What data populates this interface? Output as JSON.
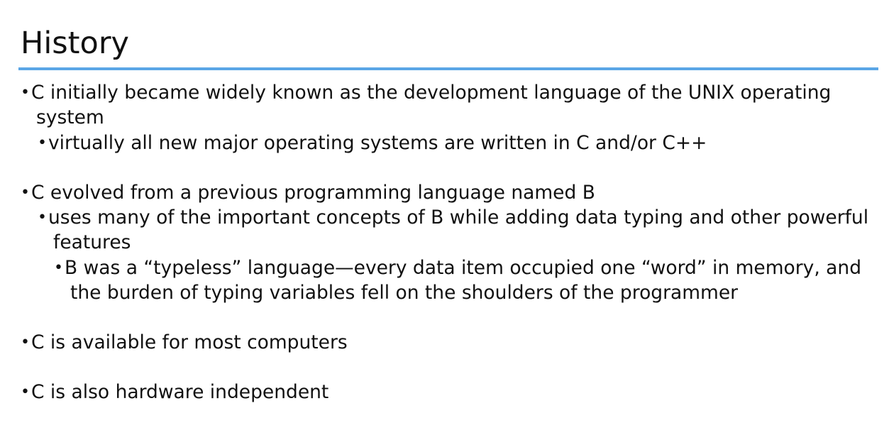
{
  "slide": {
    "title": "History",
    "accent_color": "#5aa6e6",
    "bullets": [
      {
        "level": 1,
        "lines": [
          "C initially became widely known as the development language of the UNIX operating",
          "system"
        ]
      },
      {
        "level": 2,
        "lines": [
          "virtually all new major operating systems are written in C and/or C++"
        ]
      },
      {
        "level": 1,
        "lines": [
          "C evolved from a previous programming language named B"
        ]
      },
      {
        "level": 2,
        "lines": [
          "uses many of the important concepts of B while adding data typing and other powerful",
          "features"
        ]
      },
      {
        "level": 3,
        "lines": [
          "B was a “typeless” language—every data item occupied one “word” in memory, and",
          "the burden of typing variables fell on the shoulders of the programmer"
        ]
      },
      {
        "level": 1,
        "lines": [
          "C is available for most computers"
        ]
      },
      {
        "level": 1,
        "lines": [
          "C is also hardware independent"
        ]
      }
    ]
  }
}
